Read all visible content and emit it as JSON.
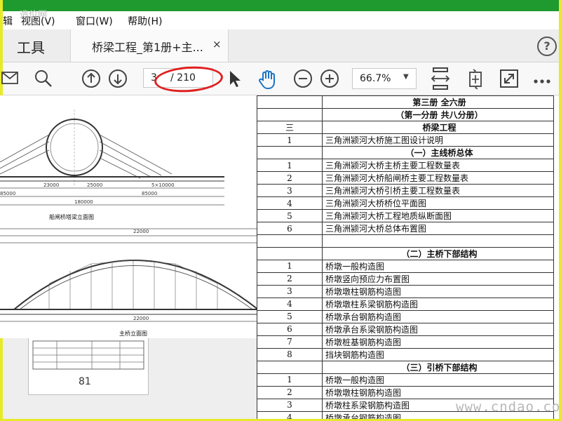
{
  "window": {
    "title": "桥梁工程_第1册+主桥...",
    "watermark_top": "造价网",
    "watermark_bottom": "www.cndao.com"
  },
  "menu": {
    "items": [
      "辑",
      "视图(V)",
      "窗口(W)",
      "帮助(H)"
    ]
  },
  "tabs": {
    "tools_label": "工具",
    "doc_label": "桥梁工程_第1册+主...",
    "close_glyph": "×",
    "help_glyph": "?"
  },
  "toolbar": {
    "page_current": "3",
    "page_total": "/ 210",
    "zoom": "66.7%",
    "zoom_caret": "▼",
    "icons": [
      "mail-icon",
      "search-icon",
      "page-up-icon",
      "page-down-icon",
      "select-cursor-icon",
      "hand-tool-icon",
      "zoom-out-icon",
      "zoom-in-icon",
      "fit-page-icon",
      "rotate-icon",
      "fullscreen-icon",
      "more-icon"
    ]
  },
  "annotation": {
    "color": "#e02020"
  },
  "sidebar": {
    "thumb_page_label": "81"
  },
  "drawing": {
    "dim_top": [
      "23000",
      "25000",
      "5×10000"
    ],
    "dim_bottom": [
      "85000",
      "85000",
      "180000"
    ],
    "caption_1": "船闸桥塔梁立面图",
    "arch_span_top": "22000",
    "arch_span_bottom": "22000",
    "caption_2": "主桥立面图"
  },
  "document": {
    "rows": [
      {
        "num": "",
        "title": "第三册  全六册",
        "center": true
      },
      {
        "num": "",
        "title": "（第一分册  共八分册）",
        "center": true
      },
      {
        "num": "三",
        "title": "桥梁工程",
        "center": true
      },
      {
        "num": "1",
        "title": "三角洲颍河大桥施工图设计说明",
        "center": false
      },
      {
        "num": "",
        "title": "（一）主线桥总体",
        "center": true
      },
      {
        "num": "1",
        "title": "三角洲颍河大桥主桥主要工程数量表",
        "center": false
      },
      {
        "num": "2",
        "title": "三角洲颍河大桥船闸桥主要工程数量表",
        "center": false
      },
      {
        "num": "3",
        "title": "三角洲颍河大桥引桥主要工程数量表",
        "center": false
      },
      {
        "num": "4",
        "title": "三角洲颍河大桥桥位平面图",
        "center": false
      },
      {
        "num": "5",
        "title": "三角洲颍河大桥工程地质纵断面图",
        "center": false
      },
      {
        "num": "6",
        "title": "三角洲颍河大桥总体布置图",
        "center": false
      },
      {
        "num": "",
        "title": "",
        "center": false
      },
      {
        "num": "",
        "title": "（二）主桥下部结构",
        "center": true
      },
      {
        "num": "1",
        "title": "桥墩一般构造图",
        "center": false
      },
      {
        "num": "2",
        "title": "桥墩竖向预应力布置图",
        "center": false
      },
      {
        "num": "3",
        "title": "桥墩墩柱钢筋构造图",
        "center": false
      },
      {
        "num": "4",
        "title": "桥墩墩柱系梁钢筋构造图",
        "center": false
      },
      {
        "num": "5",
        "title": "桥墩承台钢筋构造图",
        "center": false
      },
      {
        "num": "6",
        "title": "桥墩承台系梁钢筋构造图",
        "center": false
      },
      {
        "num": "7",
        "title": "桥墩桩基钢筋构造图",
        "center": false
      },
      {
        "num": "8",
        "title": "挡块钢筋构造图",
        "center": false
      },
      {
        "num": "",
        "title": "（三）引桥下部结构",
        "center": true
      },
      {
        "num": "1",
        "title": "桥墩一般构造图",
        "center": false
      },
      {
        "num": "2",
        "title": "桥墩墩柱钢筋构造图",
        "center": false
      },
      {
        "num": "3",
        "title": "桥墩柱系梁钢筋构造图",
        "center": false
      },
      {
        "num": "4",
        "title": "桥墩承台钢筋构造图",
        "center": false
      }
    ]
  }
}
